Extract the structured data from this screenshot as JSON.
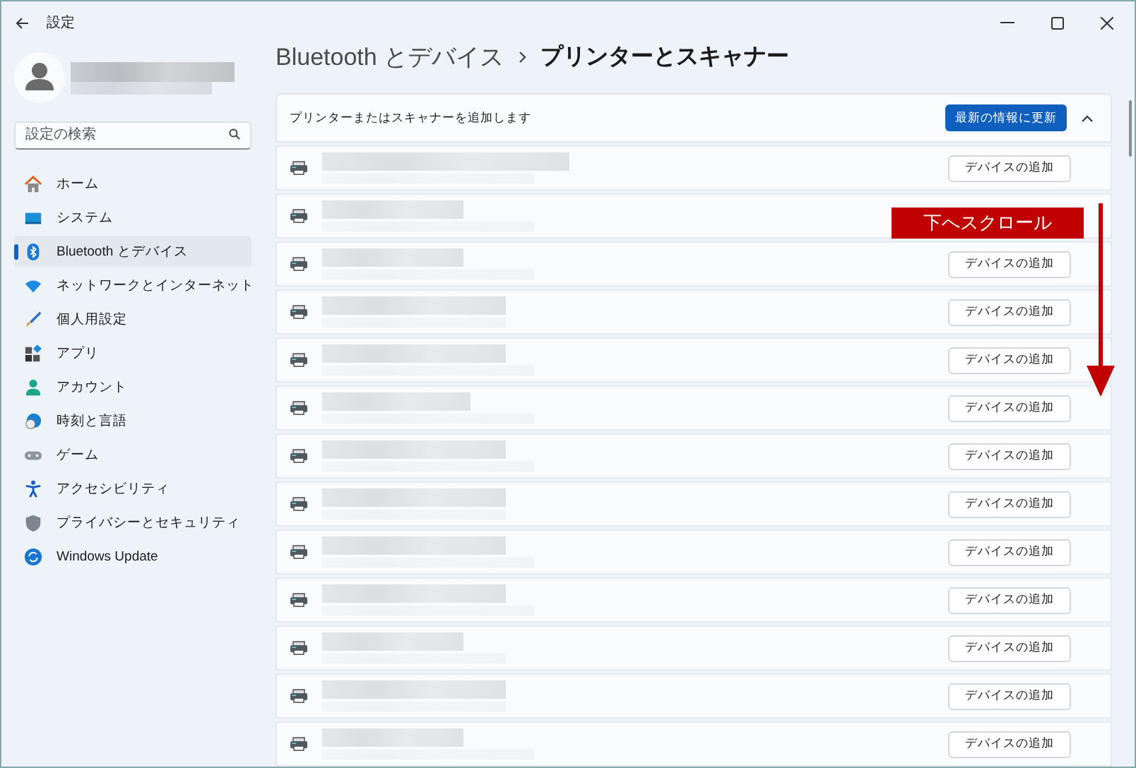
{
  "window": {
    "title": "設定"
  },
  "sidebar": {
    "search": {
      "placeholder": "設定の検索"
    },
    "items": [
      {
        "label": "ホーム",
        "selected": false
      },
      {
        "label": "システム",
        "selected": false
      },
      {
        "label": "Bluetooth とデバイス",
        "selected": true
      },
      {
        "label": "ネットワークとインターネット",
        "selected": false
      },
      {
        "label": "個人用設定",
        "selected": false
      },
      {
        "label": "アプリ",
        "selected": false
      },
      {
        "label": "アカウント",
        "selected": false
      },
      {
        "label": "時刻と言語",
        "selected": false
      },
      {
        "label": "ゲーム",
        "selected": false
      },
      {
        "label": "アクセシビリティ",
        "selected": false
      },
      {
        "label": "プライバシーとセキュリティ",
        "selected": false
      },
      {
        "label": "Windows Update",
        "selected": false
      }
    ]
  },
  "breadcrumb": {
    "parent": "Bluetooth とデバイス",
    "current": "プリンターとスキャナー"
  },
  "add_panel": {
    "label": "プリンターまたはスキャナーを追加します",
    "refresh_button": "最新の情報に更新",
    "expanded": true,
    "devices": [
      {
        "kind": "printer",
        "button": "デバイスの追加"
      },
      {
        "kind": "printer"
      },
      {
        "kind": "printer",
        "button": "デバイスの追加"
      },
      {
        "kind": "printer",
        "button": "デバイスの追加"
      },
      {
        "kind": "printer",
        "button": "デバイスの追加"
      },
      {
        "kind": "printer",
        "button": "デバイスの追加"
      },
      {
        "kind": "printer",
        "button": "デバイスの追加"
      },
      {
        "kind": "printer",
        "button": "デバイスの追加"
      },
      {
        "kind": "printer",
        "button": "デバイスの追加"
      },
      {
        "kind": "printer",
        "button": "デバイスの追加"
      },
      {
        "kind": "printer",
        "button": "デバイスの追加"
      },
      {
        "kind": "printer",
        "button": "デバイスの追加"
      },
      {
        "kind": "printer",
        "button": "デバイスの追加"
      }
    ]
  },
  "annotation": {
    "text": "下へスクロール"
  }
}
